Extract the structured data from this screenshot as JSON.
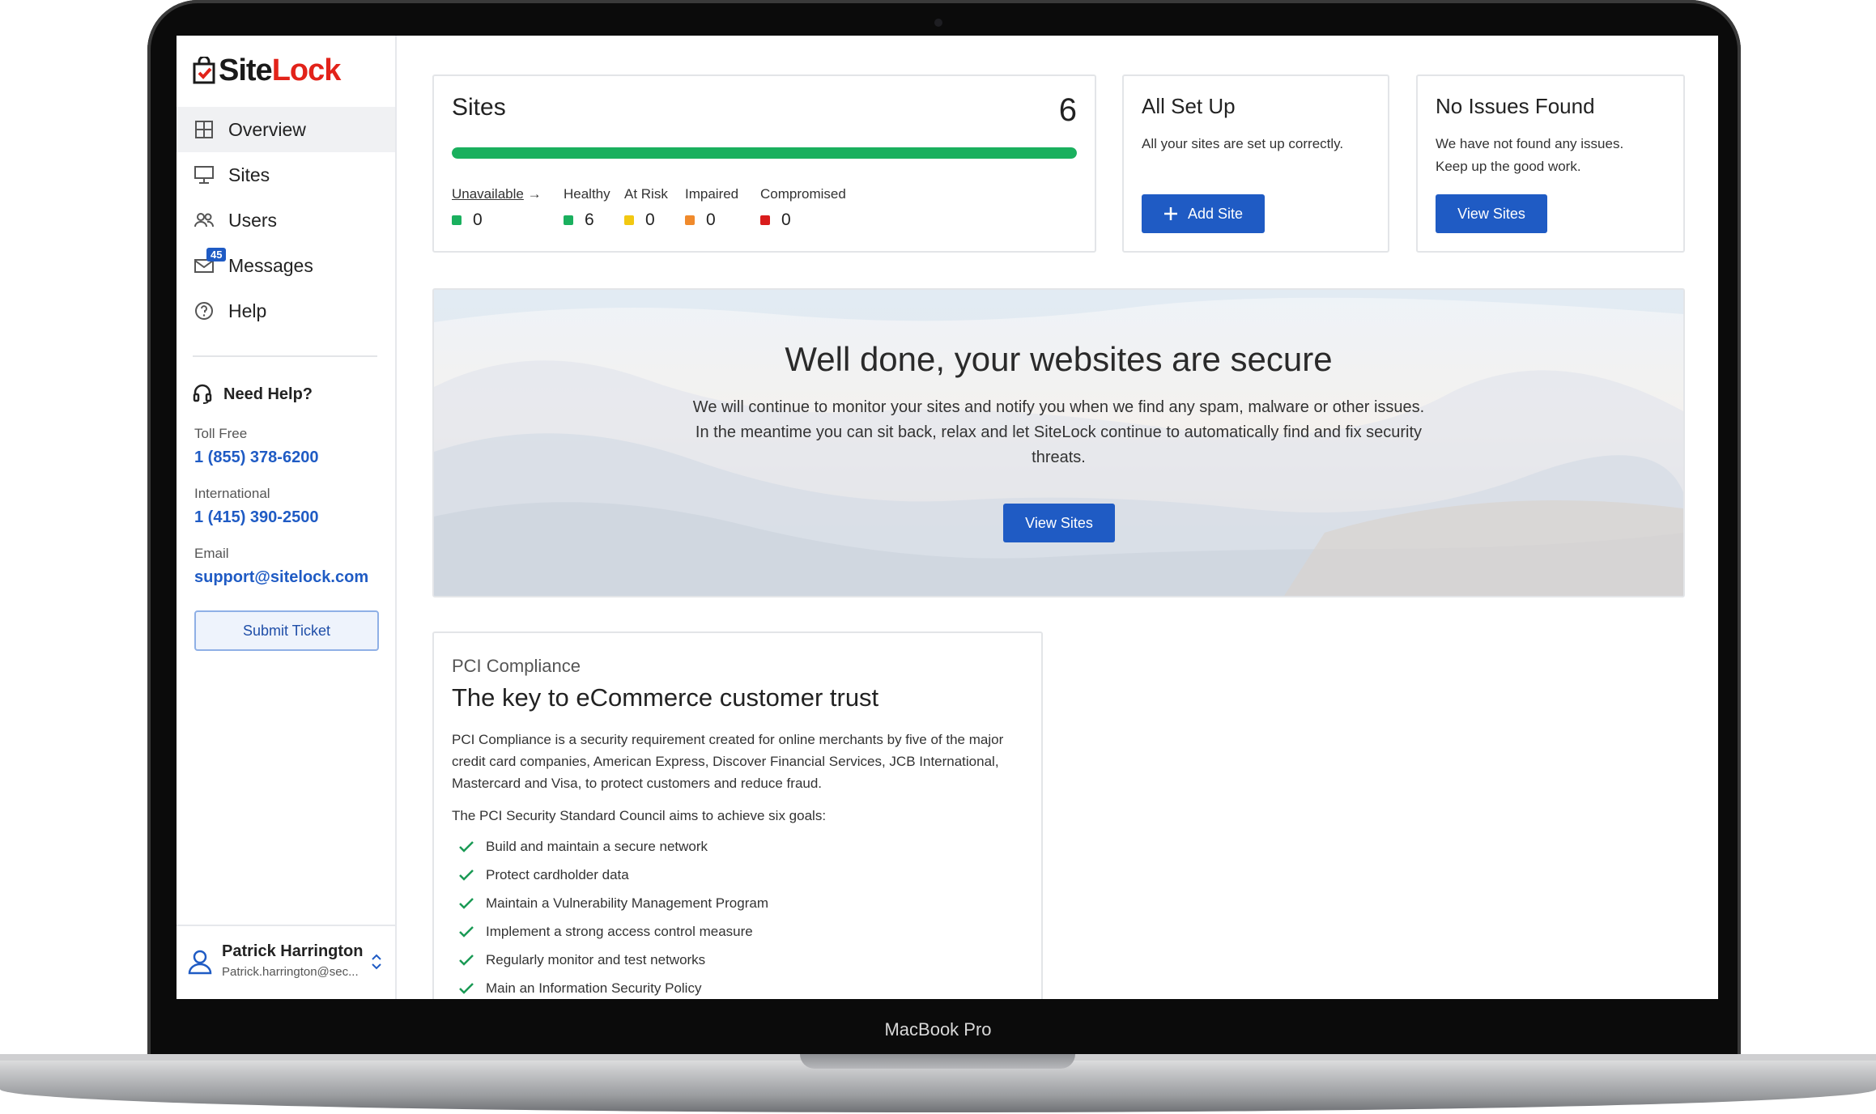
{
  "device": {
    "label": "MacBook Pro"
  },
  "brand": {
    "logo_part1": "Site",
    "logo_part2": "Lock",
    "logo_color": "#e2231a"
  },
  "sidebar": {
    "items": [
      {
        "label": "Overview",
        "icon": "grid-icon",
        "active": true
      },
      {
        "label": "Sites",
        "icon": "monitor-icon"
      },
      {
        "label": "Users",
        "icon": "users-icon"
      },
      {
        "label": "Messages",
        "icon": "mail-icon",
        "badge": "45"
      },
      {
        "label": "Help",
        "icon": "question-icon"
      }
    ],
    "help": {
      "title": "Need Help?",
      "toll_free_label": "Toll Free",
      "toll_free_value": "1 (855) 378-6200",
      "international_label": "International",
      "international_value": "1 (415) 390-2500",
      "email_label": "Email",
      "email_value": "support@sitelock.com",
      "submit_label": "Submit Ticket"
    },
    "user": {
      "name": "Patrick Harrington",
      "email": "Patrick.harrington@sec..."
    }
  },
  "sites_card": {
    "title": "Sites",
    "count": "6",
    "health_fraction": 1.0,
    "statuses": [
      {
        "label": "Unavailable",
        "value": "0",
        "color": "#1ab05e",
        "arrow": "→"
      },
      {
        "label": "Healthy",
        "value": "6",
        "color": "#1ab05e"
      },
      {
        "label": "At Risk",
        "value": "0",
        "color": "#f2c811"
      },
      {
        "label": "Impaired",
        "value": "0",
        "color": "#f08a2c"
      },
      {
        "label": "Compromised",
        "value": "0",
        "color": "#d91c1c"
      }
    ]
  },
  "setup_card": {
    "title": "All Set Up",
    "text": "All your sites are set up correctly.",
    "button": "Add Site"
  },
  "noissues_card": {
    "title": "No Issues Found",
    "text": "We have not found any issues. Keep up the good work.",
    "button": "View Sites"
  },
  "hero": {
    "title": "Well done, your websites are secure",
    "text": "We will continue to monitor your sites and notify you when we find any spam, malware or other issues. In the meantime you can sit back, relax and let SiteLock continue to automatically find and fix security threats.",
    "button": "View Sites"
  },
  "pci": {
    "kicker": "PCI Compliance",
    "title": "The key to eCommerce customer trust",
    "paragraph": "PCI Compliance is a security requirement created for online merchants by five of the major credit card companies, American Express, Discover Financial Services, JCB International, Mastercard and Visa, to protect customers and reduce fraud.",
    "goals_intro": "The PCI Security Standard Council aims to achieve six goals:",
    "goals": [
      "Build and maintain a secure network",
      "Protect cardholder data",
      "Maintain a Vulnerability Management Program",
      "Implement a strong access control measure",
      "Regularly monitor and test networks",
      "Main an Information Security Policy"
    ]
  },
  "colors": {
    "primary": "#1f5bc4",
    "healthy": "#1ab05e"
  }
}
